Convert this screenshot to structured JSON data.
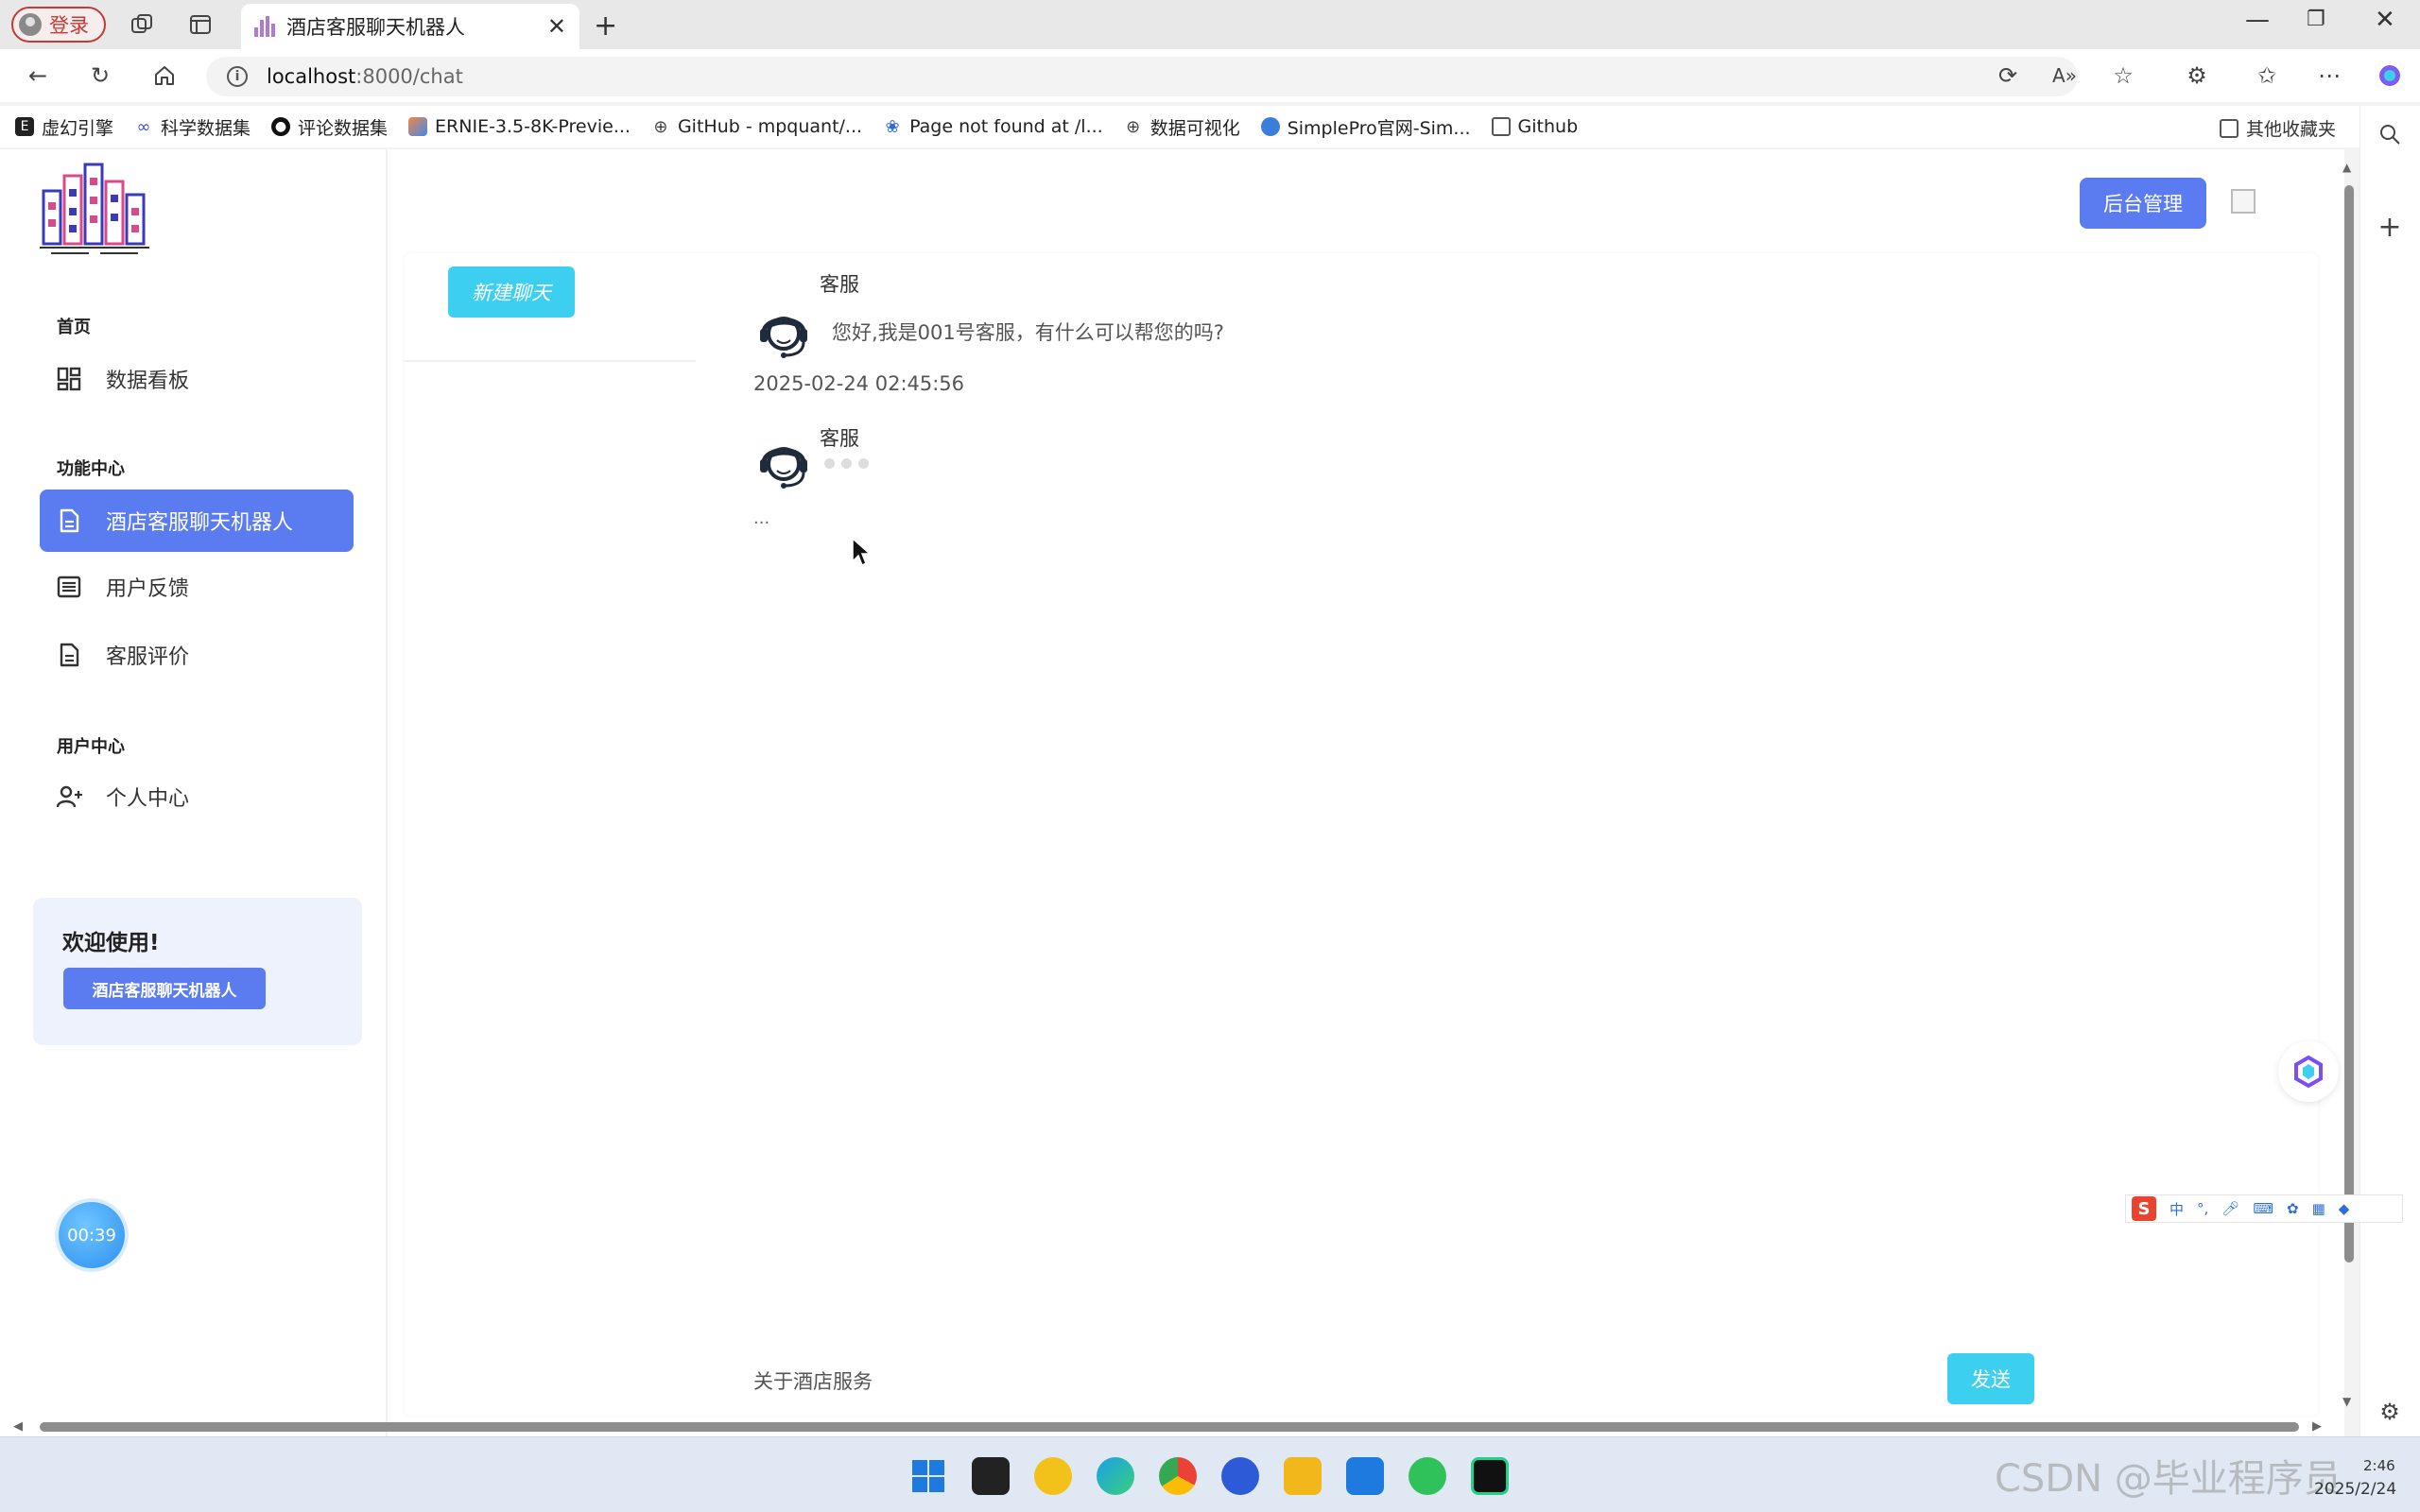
{
  "browser": {
    "profile_label": "登录",
    "tab_title": "酒店客服聊天机器人",
    "url_host": "localhost",
    "url_rest": ":8000/chat",
    "bookmarks": [
      {
        "label": "虚幻引擎",
        "icon": "epic-icon"
      },
      {
        "label": "科学数据集",
        "icon": "infinity-icon"
      },
      {
        "label": "评论数据集",
        "icon": "github-icon"
      },
      {
        "label": "ERNIE-3.5-8K-Previe...",
        "icon": "ernie-icon"
      },
      {
        "label": "GitHub - mpquant/...",
        "icon": "globe-icon"
      },
      {
        "label": "Page not found at /l...",
        "icon": "paw-icon"
      },
      {
        "label": "数据可视化",
        "icon": "globe-icon"
      },
      {
        "label": "SimplePro官网-Sim...",
        "icon": "simplepro-icon"
      },
      {
        "label": "Github",
        "icon": "folder-icon"
      }
    ],
    "other_bookmarks": "其他收藏夹"
  },
  "sidebar": {
    "groups": [
      {
        "title": "首页",
        "items": [
          {
            "label": "数据看板",
            "icon": "dashboard-icon"
          }
        ]
      },
      {
        "title": "功能中心",
        "items": [
          {
            "label": "酒店客服聊天机器人",
            "icon": "document-icon",
            "active": true
          },
          {
            "label": "用户反馈",
            "icon": "list-icon"
          },
          {
            "label": "客服评价",
            "icon": "document-icon"
          }
        ]
      },
      {
        "title": "用户中心",
        "items": [
          {
            "label": "个人中心",
            "icon": "user-add-icon"
          }
        ]
      }
    ],
    "welcome": {
      "title": "欢迎使用!",
      "button": "酒店客服聊天机器人"
    },
    "timer": "00:39"
  },
  "header": {
    "admin_button": "后台管理"
  },
  "chat": {
    "new_chat_button": "新建聊天",
    "messages": [
      {
        "sender": "客服",
        "text": "您好,我是001号客服，有什么可以帮您的吗?",
        "time": "2025-02-24 02:45:56"
      },
      {
        "sender": "客服",
        "typing": true,
        "trailing": "..."
      }
    ],
    "input_value": "关于酒店服务",
    "send_button": "发送"
  },
  "ime": {
    "logo": "S",
    "mode": "中"
  },
  "taskbar": {
    "watermark": "CSDN @毕业程序员",
    "clock_time": "2:46",
    "clock_date": "2025/2/24"
  },
  "colors": {
    "primary": "#5b7cf0",
    "accent_cyan": "#3dcff0",
    "welcome_bg": "#eef2fd"
  }
}
